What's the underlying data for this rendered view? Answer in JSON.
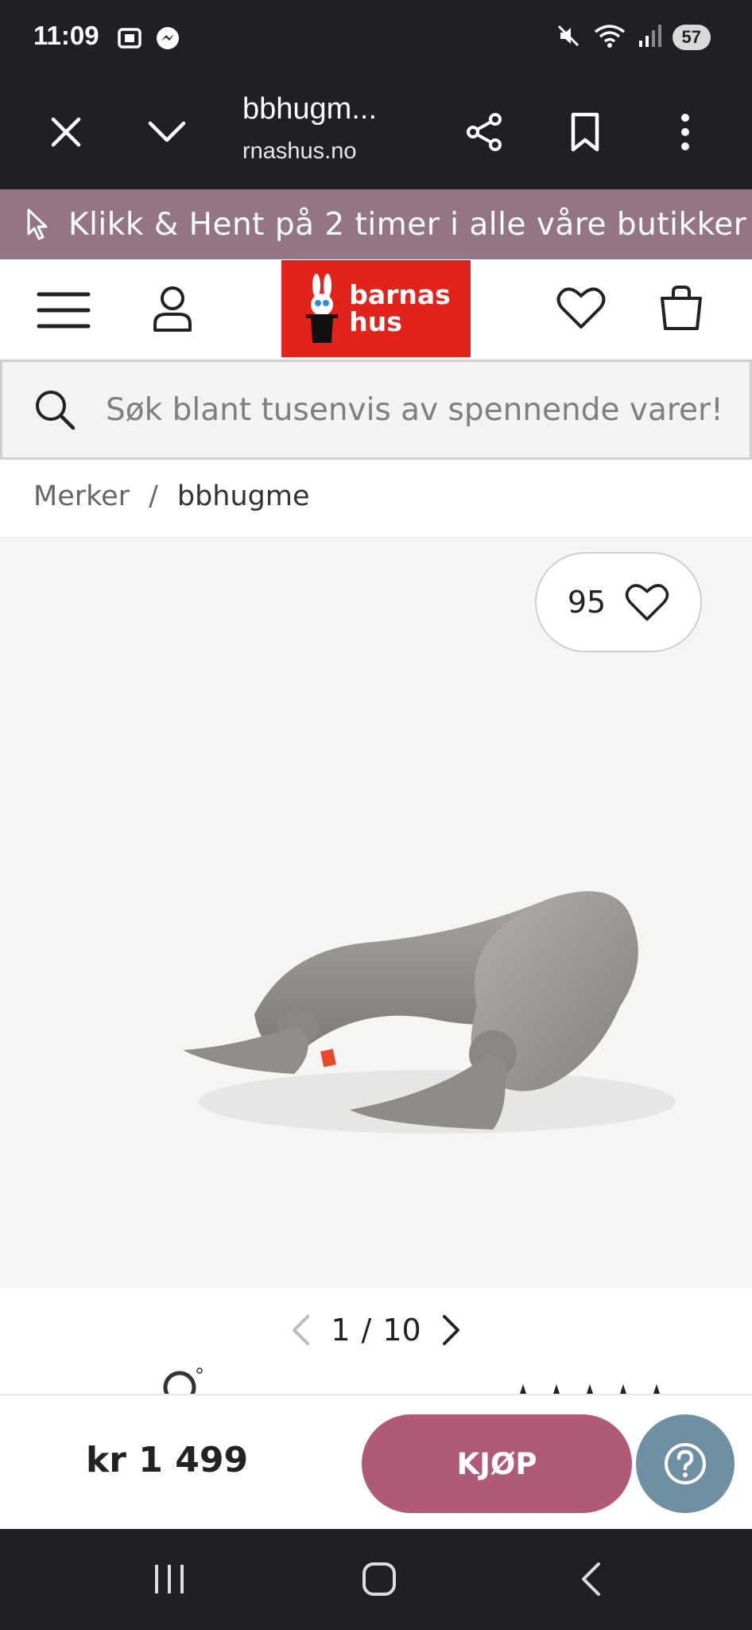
{
  "status_bar": {
    "time": "11:09",
    "battery": "57",
    "left_icons": [
      "screenshot-icon",
      "messenger-icon"
    ],
    "right_icons": [
      "mute-icon",
      "wifi-icon",
      "signal-icon",
      "battery-icon"
    ]
  },
  "browser": {
    "title": "bbhugm...",
    "url": "rnashus.no",
    "buttons": [
      "close-icon",
      "chevron-down-icon",
      "share-icon",
      "bookmark-icon",
      "more-icon"
    ]
  },
  "promo": {
    "text": "Klikk & Hent på 2 timer i alle våre butikker"
  },
  "header": {
    "logo_line1": "barnas",
    "logo_line2": "hus",
    "brand_color": "#e2231a"
  },
  "search": {
    "placeholder": "Søk blant tusenvis av spennende varer!"
  },
  "breadcrumb": {
    "items": [
      "Merker",
      "bbhugme"
    ],
    "separator": "/"
  },
  "product": {
    "like_count": "95",
    "image_index": "1",
    "image_total": "10"
  },
  "buy_bar": {
    "price": "kr 1 499",
    "buy_label": "KJØP",
    "buy_color": "#b05a78",
    "help_color": "#6f8fa3"
  }
}
